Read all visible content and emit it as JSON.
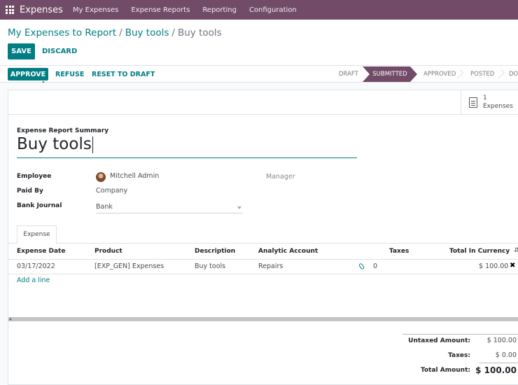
{
  "navbar": {
    "brand": "Expenses",
    "menu": [
      "My Expenses",
      "Expense Reports",
      "Reporting",
      "Configuration"
    ]
  },
  "breadcrumb": {
    "items": [
      "My Expenses to Report",
      "Buy tools"
    ],
    "current": "Buy tools",
    "separator": "/"
  },
  "actions": {
    "save": "SAVE",
    "discard": "DISCARD"
  },
  "statusbar": {
    "buttons": {
      "approve": "APPROVE",
      "refuse": "REFUSE",
      "reset": "RESET TO DRAFT"
    },
    "stages": [
      "DRAFT",
      "SUBMITTED",
      "APPROVED",
      "POSTED",
      "DO"
    ],
    "active_stage": "SUBMITTED"
  },
  "smart_button": {
    "value": "1",
    "label": "Expenses",
    "icon": "document-icon"
  },
  "form": {
    "summary_label": "Expense Report Summary",
    "summary_value": "Buy tools",
    "employee_label": "Employee",
    "employee_value": "Mitchell Admin",
    "manager_label": "Manager",
    "paid_by_label": "Paid By",
    "paid_by_value": "Company",
    "journal_label": "Bank Journal",
    "journal_value": "Bank"
  },
  "tabs": [
    "Expense"
  ],
  "table": {
    "headers": [
      "Expense Date",
      "Product",
      "Description",
      "Analytic Account",
      "Taxes",
      "Total In Currency"
    ],
    "rows": [
      {
        "date": "03/17/2022",
        "product": "[EXP_GEN] Expenses",
        "description": "Buy tools",
        "analytic": "Repairs",
        "attachments": "0",
        "taxes": "",
        "total": "$ 100.00"
      }
    ],
    "add_line": "Add a line"
  },
  "totals": {
    "untaxed_label": "Untaxed Amount:",
    "untaxed_value": "$ 100.00",
    "taxes_label": "Taxes:",
    "taxes_value": "$ 0.00",
    "total_label": "Total Amount:",
    "total_value": "$ 100.00"
  },
  "colors": {
    "brand": "#714B67",
    "accent": "#017e84"
  }
}
